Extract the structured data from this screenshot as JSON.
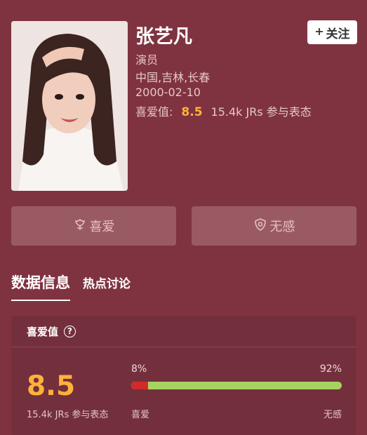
{
  "profile": {
    "name": "张艺凡",
    "role": "演员",
    "location": "中国,吉林,长春",
    "birthday": "2000-02-10",
    "score_label": "喜爱值:",
    "score": "8.5",
    "votes_text": "15.4k JRs 参与表态"
  },
  "follow_button": {
    "icon": "plus-icon",
    "label": "关注"
  },
  "actions": {
    "like": {
      "icon": "flower-icon",
      "label": "喜爱"
    },
    "dislike": {
      "icon": "shield-icon",
      "label": "无感"
    }
  },
  "tabs": [
    {
      "label": "数据信息",
      "active": true
    },
    {
      "label": "热点讨论",
      "active": false
    }
  ],
  "rating_panel": {
    "title": "喜爱值",
    "help_icon": "question-icon",
    "help_glyph": "?",
    "score": "8.5",
    "votes_text": "15.4k JRs 参与表态",
    "like_pct_text": "8%",
    "dislike_pct_text": "92%",
    "like_fraction": 0.08,
    "like_label": "喜爱",
    "dislike_label": "无感",
    "colors": {
      "like": "#d12a2a",
      "dislike": "#a5d560",
      "score": "#ffb23a"
    }
  },
  "colors": {
    "background": "#7f3340",
    "button": "#9a5a64",
    "panel": "#73303c"
  }
}
